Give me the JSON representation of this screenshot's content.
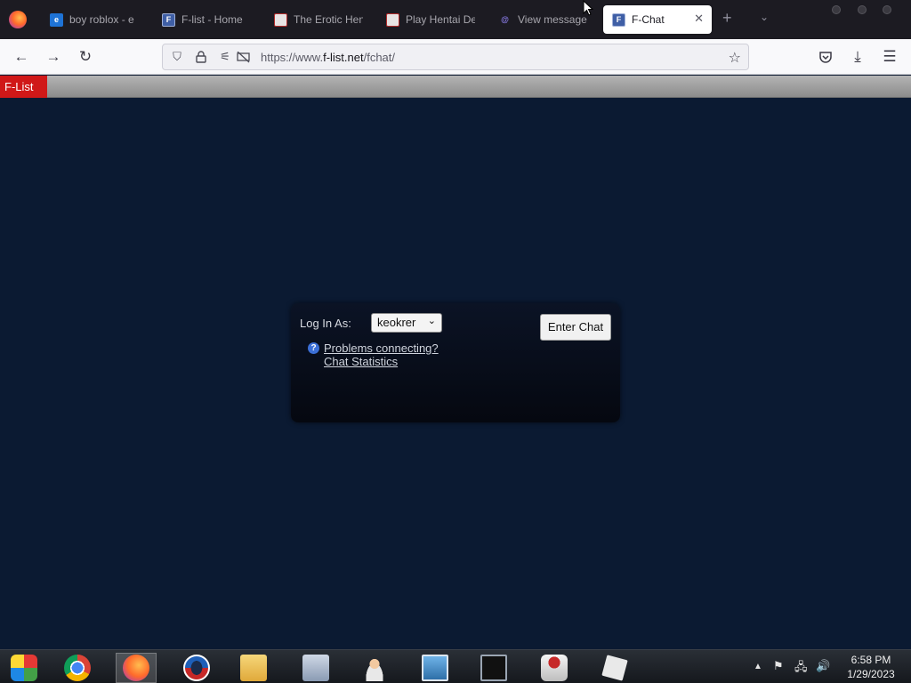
{
  "browser": {
    "tabs": [
      {
        "label": "boy roblox - e",
        "favicon": "edge-icon"
      },
      {
        "label": "F-list - Home",
        "favicon": "f-list-icon"
      },
      {
        "label": "The Erotic Hen",
        "favicon": "hentai-site-icon"
      },
      {
        "label": "Play Hentai Dei",
        "favicon": "hentai-site-icon"
      },
      {
        "label": "View message",
        "favicon": "at-sign-icon"
      },
      {
        "label": "F-Chat",
        "favicon": "f-list-icon",
        "active": true
      }
    ],
    "url_prefix": "https://www.",
    "url_domain": "f-list.net",
    "url_path": "/fchat/"
  },
  "flist": {
    "brand": "F-List"
  },
  "login": {
    "log_in_as_label": "Log In As:",
    "selected_character": "keokrer",
    "enter_chat_label": "Enter Chat",
    "problems_link": "Problems connecting?",
    "stats_link": "Chat Statistics",
    "help_glyph": "?"
  },
  "taskbar": {
    "apps": [
      "windows-start-icon",
      "chrome-icon",
      "firefox-icon",
      "opera-icon",
      "file-explorer-icon",
      "monitor-icon",
      "user-support-icon",
      "photo-viewer-icon",
      "command-prompt-icon",
      "java-icon",
      "roblox-icon"
    ],
    "time": "6:58 PM",
    "date": "1/29/2023"
  },
  "colors": {
    "page_background": "#0b1a32",
    "flist_red": "#d01818"
  }
}
